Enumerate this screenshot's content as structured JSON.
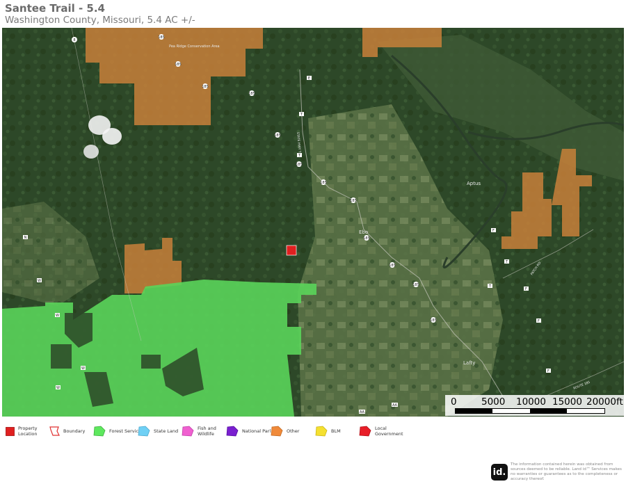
{
  "header": {
    "title": "Santee Trail - 5.4",
    "subtitle": "Washington County, Missouri, 5.4 AC +/-"
  },
  "map": {
    "place_labels": [
      "Ebo",
      "Aptus",
      "Lafty",
      "Pea Ridge\nConservation Area"
    ],
    "route_labels": [
      "8",
      "185",
      "185",
      "185",
      "185",
      "185",
      "185",
      "185",
      "185",
      "185",
      "185",
      "185",
      "185",
      "E",
      "T",
      "T",
      "N",
      "W",
      "W",
      "W",
      "W",
      "F",
      "F",
      "F",
      "F",
      "T",
      "T",
      "AA",
      "AA"
    ],
    "road_labels": [
      "STATE HWY T",
      "PATCH RD",
      "ROUTE 185"
    ],
    "colors": {
      "forest_service": "#5ad45a",
      "other": "#c8803a",
      "property": "#e02020",
      "boundary": "#e03030"
    }
  },
  "scalebar": {
    "labels": [
      "0",
      "5000",
      "10000",
      "15000",
      "20000ft"
    ]
  },
  "legend": {
    "items": [
      {
        "label": "Property\nLocation",
        "icon": "square-icon",
        "color": "#e02020"
      },
      {
        "label": "Boundary",
        "icon": "outline-pentagon-icon",
        "color": "#e03030"
      },
      {
        "label": "Forest Servic",
        "icon": "pentagon-icon",
        "color": "#5ee85e"
      },
      {
        "label": "State Land",
        "icon": "pentagon-icon",
        "color": "#6fd0f5"
      },
      {
        "label": "Fish and\nWildlife",
        "icon": "pentagon-icon",
        "color": "#f060d0"
      },
      {
        "label": "National Parl",
        "icon": "pentagon-icon",
        "color": "#7a1fd0"
      },
      {
        "label": "Other",
        "icon": "pentagon-icon",
        "color": "#f08a3a"
      },
      {
        "label": "BLM",
        "icon": "pentagon-icon",
        "color": "#f5e030"
      },
      {
        "label": "Local\nGovernment",
        "icon": "pentagon-icon",
        "color": "#e81e28"
      }
    ]
  },
  "footer": {
    "logo": "id.",
    "disclaimer": "The information contained herein was obtained from sources deemed to be reliable. Land id™ Services makes no warranties or guarantees as to the completeness or accuracy thereof."
  }
}
